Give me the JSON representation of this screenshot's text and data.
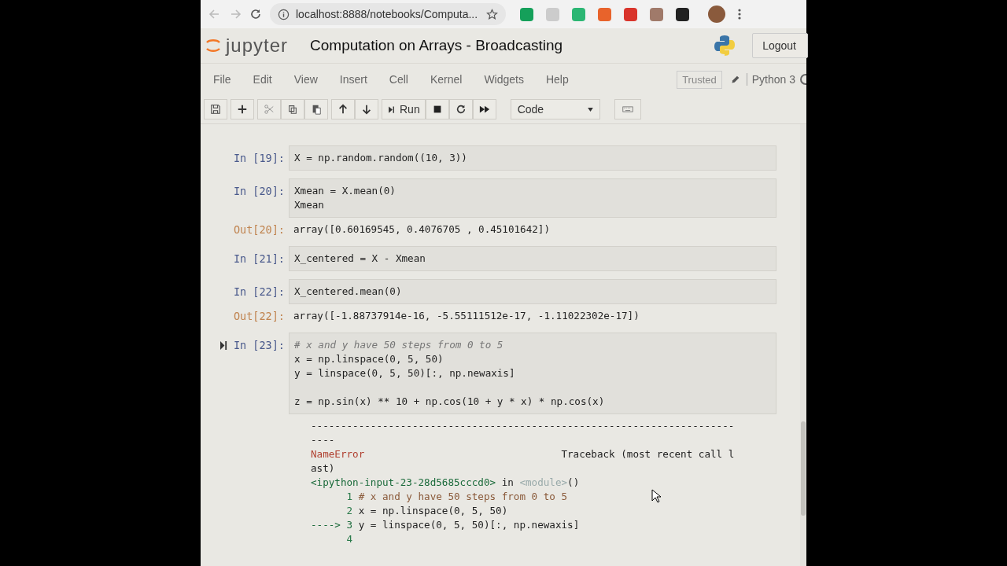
{
  "browser": {
    "url": "localhost:8888/notebooks/Computa...",
    "extensions": [
      {
        "color": "#15a05a"
      },
      {
        "color": "#cccccc"
      },
      {
        "color": "#2bb673"
      },
      {
        "color": "#e8632b"
      },
      {
        "color": "#d9342b"
      },
      {
        "color": "#a07a6a"
      },
      {
        "color": "#222222"
      }
    ]
  },
  "header": {
    "logo": "jupyter",
    "notebook_title": "Computation on Arrays - Broadcasting",
    "logout": "Logout"
  },
  "menu": {
    "items": [
      "File",
      "Edit",
      "View",
      "Insert",
      "Cell",
      "Kernel",
      "Widgets",
      "Help"
    ],
    "trusted": "Trusted",
    "kernel": "Python 3"
  },
  "toolbar": {
    "run": "Run",
    "cell_type": "Code"
  },
  "cells": [
    {
      "kind": "input",
      "prompt": "In [19]:",
      "selected": false,
      "lines": [
        [
          {
            "text": "X = np.random.random((10, 3))",
            "kind": "code"
          }
        ]
      ]
    },
    {
      "kind": "input",
      "prompt": "In [20]:",
      "selected": false,
      "lines": [
        [
          {
            "text": "Xmean = X.mean(0)",
            "kind": "code"
          }
        ],
        [
          {
            "text": "Xmean",
            "kind": "code"
          }
        ]
      ]
    },
    {
      "kind": "output",
      "prompt": "Out[20]:",
      "lines": [
        [
          {
            "text": "array([0.60169545, 0.4076705 , 0.45101642])",
            "kind": "code"
          }
        ]
      ]
    },
    {
      "kind": "input",
      "prompt": "In [21]:",
      "selected": false,
      "lines": [
        [
          {
            "text": "X_centered = X - Xmean",
            "kind": "code"
          }
        ]
      ]
    },
    {
      "kind": "input",
      "prompt": "In [22]:",
      "selected": false,
      "lines": [
        [
          {
            "text": "X_centered.mean(0)",
            "kind": "code"
          }
        ]
      ]
    },
    {
      "kind": "output",
      "prompt": "Out[22]:",
      "lines": [
        [
          {
            "text": "array([-1.88737914e-16, -5.55111512e-17, -1.11022302e-17])",
            "kind": "code"
          }
        ]
      ]
    },
    {
      "kind": "input",
      "prompt": "In [23]:",
      "selected": true,
      "lines": [
        [
          {
            "text": "# x and y have 50 steps from 0 to 5",
            "kind": "comment"
          }
        ],
        [
          {
            "text": "x = np.linspace(0, 5, 50)",
            "kind": "code"
          }
        ],
        [
          {
            "text": "y = linspace(0, 5, 50)[:, np.newaxis]",
            "kind": "code"
          }
        ],
        [
          {
            "kind": "blank"
          }
        ],
        [
          {
            "text": "z = np.sin(x) ** 10 + np.cos(10 + y * x) * np.cos(x)",
            "kind": "code"
          }
        ]
      ]
    },
    {
      "kind": "error",
      "lines": [
        [
          {
            "text": "-----------------------------------------------------------------------",
            "kind": "code"
          }
        ],
        [
          {
            "text": "----",
            "kind": "code"
          }
        ],
        [
          {
            "text": "NameError",
            "kind": "error"
          },
          {
            "text": "                                 Traceback (most recent call l",
            "kind": "code"
          }
        ],
        [
          {
            "text": "ast)",
            "kind": "code"
          }
        ],
        [
          {
            "text": "<ipython-input-23-28d5685cccd0>",
            "kind": "name"
          },
          {
            "text": " in ",
            "kind": "code"
          },
          {
            "text": "<module>",
            "kind": "dim"
          },
          {
            "text": "()",
            "kind": "code"
          }
        ],
        [
          {
            "text": "      1 ",
            "kind": "num"
          },
          {
            "text": "# x and y have 50 steps from 0 to 5",
            "kind": "tbcomment"
          }
        ],
        [
          {
            "text": "      2 ",
            "kind": "num"
          },
          {
            "text": "x = np.linspace(0, 5, 50)",
            "kind": "code"
          }
        ],
        [
          {
            "text": "----> 3 ",
            "kind": "name"
          },
          {
            "text": "y = linspace(0, 5, 50)[:, np.newaxis]",
            "kind": "code"
          }
        ],
        [
          {
            "text": "      4",
            "kind": "num"
          }
        ]
      ]
    }
  ]
}
